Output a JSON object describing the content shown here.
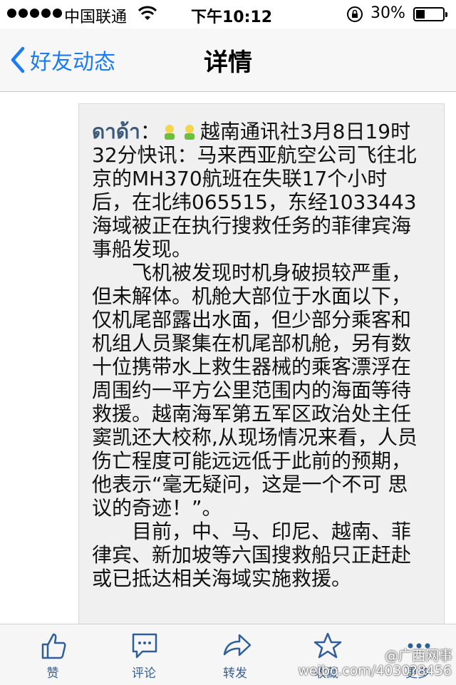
{
  "status_bar": {
    "carrier": "中国联通",
    "time": "下午10:12",
    "battery": "30%",
    "icons": [
      "signal-icon",
      "wifi-icon",
      "orientation-lock-icon",
      "battery-icon"
    ]
  },
  "nav": {
    "back_label": "好友动态",
    "title": "详情"
  },
  "post": {
    "author": "ดาด้า",
    "separator": "：",
    "p1": "越南通讯社3月8日19时32分快讯：马来西亚航空公司飞往北京的MH370航班在失联17个小时后，在北纬065515，东经1033443海域被正在执行搜救任务的菲律宾海事船发现。",
    "p2": "飞机被发现时机身破损较严重，但未解体。机舱大部位于水面以下，仅机尾部露出水面，但少部分乘客和机组人员聚集在机尾部机舱，另有数十位携带水上救生器械的乘客漂浮在周围约一平方公里范围内的海面等待救援。越南海军第五军区政治处主任窦凯还大校称,从现场情况来看，人员伤亡程度可能远远低于此前的预期，他表示“毫无疑问，这是一个不可 思议的奇迹！”。",
    "p3": "目前，中、马、印尼、越南、菲律宾、新加坡等六国搜救船只正赶赴或已抵达相关海域实施救援。"
  },
  "toolbar": {
    "like": "赞",
    "comment": "评论",
    "share": "转发",
    "favorite": "收藏",
    "more": "更多"
  },
  "watermark": {
    "handle": "@广西网事",
    "url": "weibo.com/4030?8456"
  },
  "colors": {
    "accent": "#1a7cf5",
    "toolbar_icon": "#2f5e9a",
    "author": "#3c5a7a"
  }
}
